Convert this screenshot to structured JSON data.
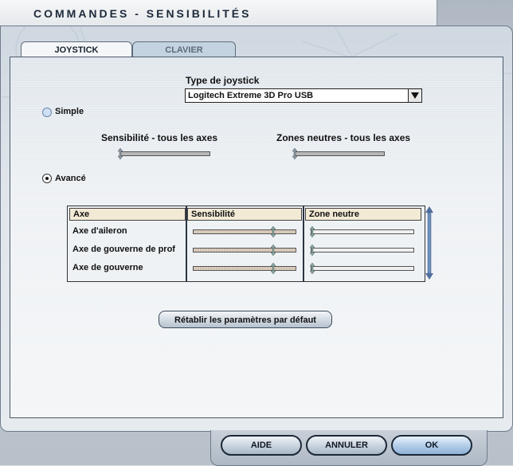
{
  "window": {
    "title": "COMMANDES - SENSIBILITÉS"
  },
  "tabs": [
    {
      "label": "JOYSTICK",
      "active": true
    },
    {
      "label": "CLAVIER",
      "active": false
    }
  ],
  "joystick_type": {
    "label": "Type de joystick",
    "selected": "Logitech Extreme 3D Pro USB"
  },
  "mode": {
    "simple_label": "Simple",
    "simple_selected": false,
    "advanced_label": "Avancé",
    "advanced_selected": true
  },
  "simple_settings": {
    "sensitivity_label": "Sensibilité - tous les axes",
    "sensitivity_level": 0.0,
    "deadzone_label": "Zones neutres - tous les axes",
    "deadzone_level": 0.0
  },
  "axes_table": {
    "headers": [
      "Axe",
      "Sensibilité",
      "Zone neutre"
    ],
    "rows": [
      {
        "axis": "Axe d'aileron",
        "sensitivity": 0.78,
        "deadzone": 0.0
      },
      {
        "axis": "Axe de gouverne de prof",
        "sensitivity": 0.78,
        "deadzone": 0.0
      },
      {
        "axis": "Axe de gouverne",
        "sensitivity": 0.78,
        "deadzone": 0.0
      }
    ]
  },
  "buttons": {
    "reset": "Rétablir les paramètres par défaut",
    "help": "AIDE",
    "cancel": "ANNULER",
    "ok": "OK"
  },
  "colors": {
    "header_bg": "#f3ead6",
    "ok_button": "#b0cbe8"
  }
}
